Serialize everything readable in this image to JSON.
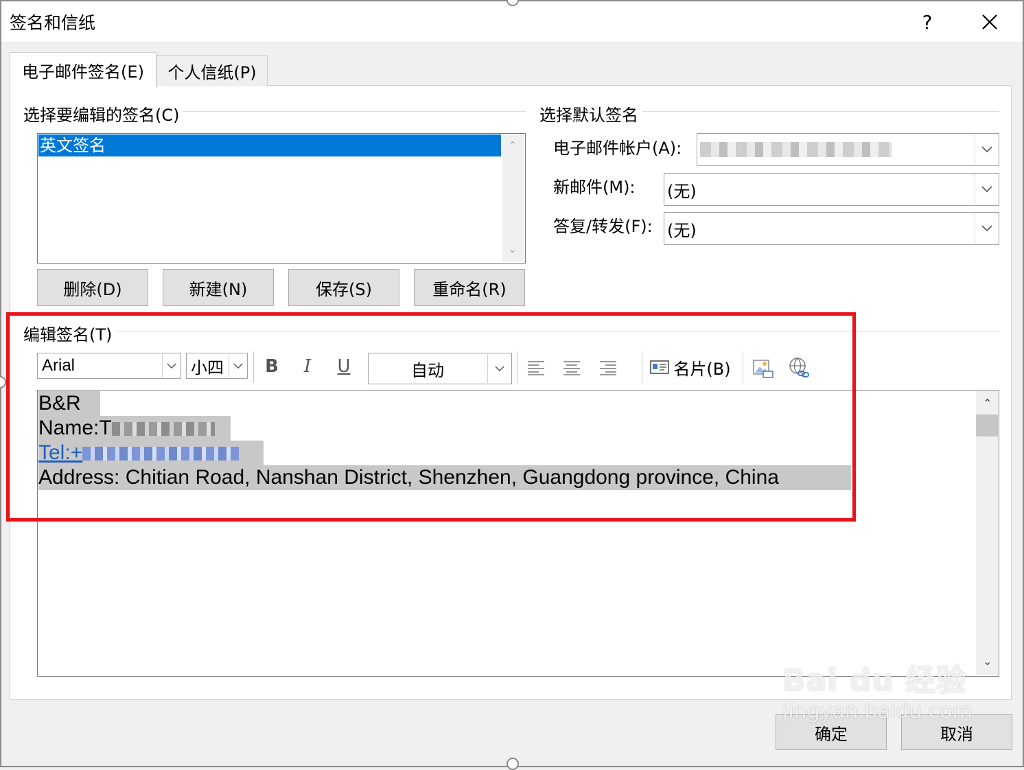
{
  "window": {
    "title": "签名和信纸",
    "help_label": "?",
    "close_icon": "close-icon"
  },
  "tabs": [
    {
      "label": "电子邮件签名(E)",
      "active": true
    },
    {
      "label": "个人信纸(P)",
      "active": false
    }
  ],
  "select_signature": {
    "group_label": "选择要编辑的签名(C)",
    "items": [
      "英文签名"
    ],
    "selected_index": 0
  },
  "signature_buttons": {
    "delete": "删除(D)",
    "new": "新建(N)",
    "save": "保存(S)",
    "rename": "重命名(R)"
  },
  "default_signature": {
    "group_label": "选择默认签名",
    "account_label": "电子邮件帐户(A):",
    "account_value": "",
    "new_message_label": "新邮件(M):",
    "new_message_value": "(无)",
    "reply_label": "答复/转发(F):",
    "reply_value": "(无)"
  },
  "edit_signature": {
    "group_label": "编辑签名(T)",
    "font": "Arial",
    "size": "小四",
    "bold": "B",
    "italic": "I",
    "underline": "U",
    "color": "自动",
    "business_card": "名片(B)",
    "icons": [
      "align-left-icon",
      "align-center-icon",
      "align-right-icon",
      "business-card-icon",
      "insert-picture-icon",
      "insert-hyperlink-icon"
    ]
  },
  "signature_text": {
    "line1": "B&R",
    "line2_prefix": "Name:T",
    "line3_prefix": "Tel:+",
    "line4": "Address: Chitian Road, Nanshan District, Shenzhen, Guangdong province, China"
  },
  "footer": {
    "ok": "确定",
    "cancel": "取消"
  },
  "watermark": {
    "brand": "Bai du 经验",
    "url": "jingyan.baidu.com"
  },
  "colors": {
    "selection": "#0078d7",
    "highlight_box": "#e8121a",
    "link": "#1f5fbf"
  }
}
